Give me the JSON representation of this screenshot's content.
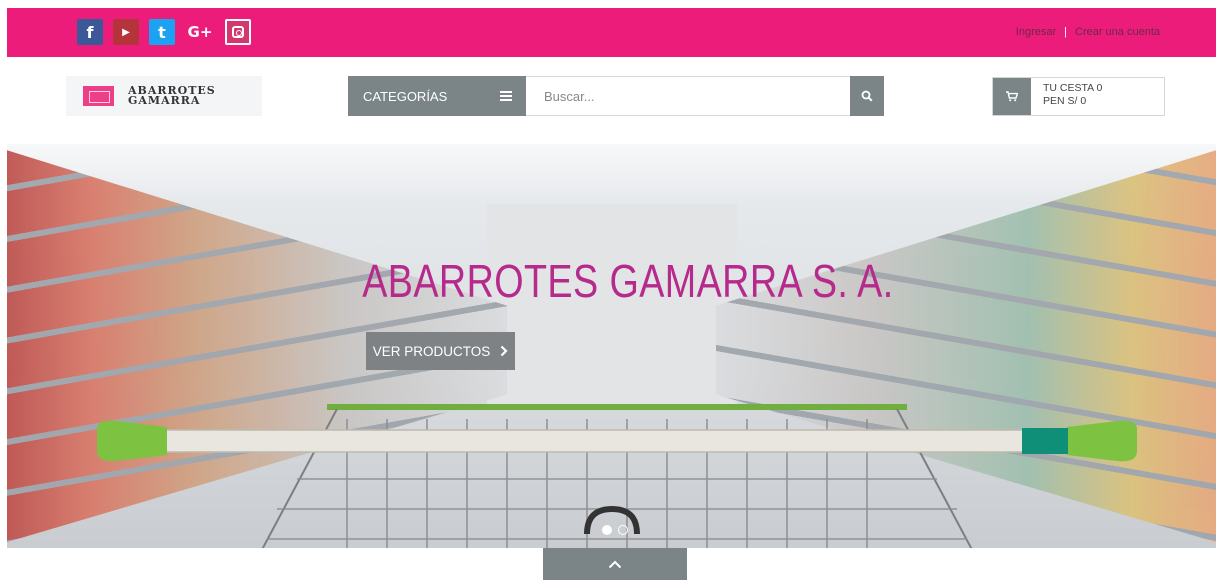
{
  "topbar": {
    "social": [
      {
        "name": "facebook",
        "glyph": "f",
        "icon": "facebook-icon"
      },
      {
        "name": "youtube",
        "glyph": "You\nTube",
        "icon": "youtube-icon"
      },
      {
        "name": "twitter",
        "glyph": "t",
        "icon": "twitter-icon"
      },
      {
        "name": "google-plus",
        "glyph": "G+",
        "icon": "google-plus-icon"
      },
      {
        "name": "instagram",
        "glyph": "",
        "icon": "instagram-icon"
      }
    ],
    "login_label": "Ingresar",
    "separator": "|",
    "register_label": "Crear una cuenta",
    "color": "#ec1c7b"
  },
  "header": {
    "logo_text_line1": "ABARROTES",
    "logo_text_line2": "GAMARRA",
    "categories_label": "CATEGORÍAS",
    "search_placeholder": "Buscar...",
    "cart_line1": "TU CESTA 0",
    "cart_line2": "PEN S/ 0"
  },
  "hero": {
    "title": "ABARROTES GAMARRA S. A.",
    "button_label": "VER PRODUCTOS",
    "slides_total": 2,
    "active_slide": 1,
    "title_color": "#b62a8c"
  },
  "colors": {
    "accent": "#ec1c7b",
    "gray_button": "#7b8588"
  }
}
